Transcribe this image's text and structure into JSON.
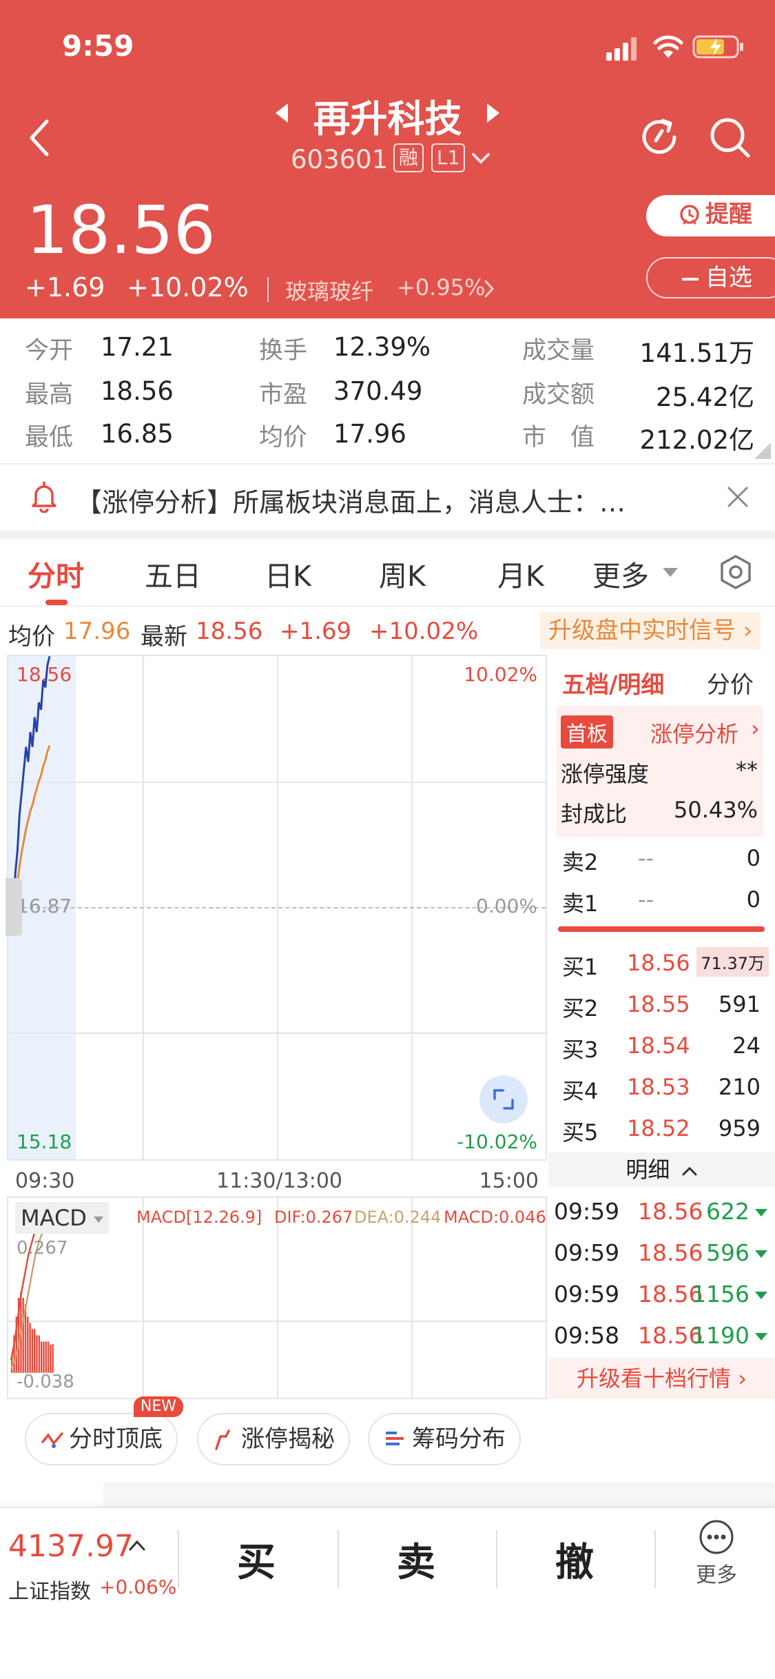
{
  "status": {
    "time": "9:59"
  },
  "header": {
    "title": "再升科技",
    "code": "603601",
    "tag_margin": "融",
    "tag_level": "L1",
    "price": "18.56",
    "change": "+1.69",
    "change_pct": "+10.02%",
    "sector_name": "玻璃玻纤",
    "sector_change": "+0.95%",
    "remind_label": "提醒",
    "watchlist_label": "自选",
    "colors": {
      "header_bg": "#e0524b",
      "up": "#e84a3d",
      "down": "#1f9e4a"
    }
  },
  "stats": [
    {
      "label": "今开",
      "value": "17.21",
      "color": "red"
    },
    {
      "label": "换手",
      "value": "12.39%",
      "color": "normal"
    },
    {
      "label": "成交量",
      "value": "141.51万",
      "color": "normal"
    },
    {
      "label": "最高",
      "value": "18.56",
      "color": "red"
    },
    {
      "label": "市盈",
      "value": "370.49",
      "color": "normal"
    },
    {
      "label": "成交额",
      "value": "25.42亿",
      "color": "normal"
    },
    {
      "label": "最低",
      "value": "16.85",
      "color": "green"
    },
    {
      "label": "均价",
      "value": "17.96",
      "color": "red"
    },
    {
      "label": "市　值",
      "value": "212.02亿",
      "color": "normal"
    }
  ],
  "notice": {
    "text": "【涨停分析】所属板块消息面上，消息人士：…"
  },
  "tabs": [
    "分时",
    "五日",
    "日K",
    "周K",
    "月K",
    "更多"
  ],
  "chart_header": {
    "avg_label": "均价",
    "avg_value": "17.96",
    "latest_label": "最新",
    "latest_value": "18.56",
    "change": "+1.69",
    "change_pct": "+10.02%",
    "upgrade_signal": "升级盘中实时信号"
  },
  "chart_data": {
    "type": "line",
    "y_labels": {
      "top": "18.56",
      "mid": "16.87",
      "bottom": "15.18",
      "top_pct": "10.02%",
      "mid_pct": "0.00%",
      "bottom_pct": "-10.02%"
    },
    "ylim": [
      15.18,
      18.56
    ],
    "x_labels": [
      "09:30",
      "11:30/13:00",
      "15:00"
    ],
    "series": [
      {
        "values": [
          16.95,
          16.8,
          17.1,
          17.25,
          17.5,
          17.65,
          17.8,
          17.95,
          17.85,
          18.05,
          17.95,
          18.15,
          18.05,
          18.25,
          18.2,
          18.4,
          18.35,
          18.5,
          18.56
        ]
      },
      {
        "values": [
          16.88,
          16.82,
          16.95,
          17.05,
          17.15,
          17.25,
          17.32,
          17.4,
          17.46,
          17.52,
          17.56,
          17.62,
          17.67,
          17.72,
          17.76,
          17.82,
          17.86,
          17.92,
          17.96
        ]
      }
    ]
  },
  "macd": {
    "label": "MACD",
    "params": "MACD[12.26.9]",
    "dif": "DIF:0.267",
    "dea": "DEA:0.244",
    "macd": "MACD:0.046",
    "top_label": "0.267",
    "bottom_label": "-0.038",
    "dif_values": [
      0.02,
      0.05,
      0.09,
      0.13,
      0.16,
      0.19,
      0.21,
      0.23,
      0.245,
      0.255,
      0.262,
      0.267
    ],
    "dea_values": [
      0.005,
      0.02,
      0.04,
      0.07,
      0.1,
      0.13,
      0.16,
      0.19,
      0.21,
      0.225,
      0.236,
      0.244
    ],
    "hist_values": [
      0.03,
      0.06,
      0.09,
      0.12,
      0.13,
      0.12,
      0.11,
      0.09,
      0.08,
      0.07,
      0.07,
      0.06,
      0.06,
      0.05,
      0.05,
      0.05,
      0.05,
      0.045,
      0.046
    ]
  },
  "order_book": {
    "title": "五档/明细",
    "alt_label": "分价",
    "badge": "首板",
    "limit_analysis": "涨停分析",
    "strength_label": "涨停强度",
    "strength_value": "**",
    "seal_ratio_label": "封成比",
    "seal_ratio_value": "50.43%",
    "asks": [
      {
        "label": "卖2",
        "price": "--",
        "volume": "0"
      },
      {
        "label": "卖1",
        "price": "--",
        "volume": "0"
      }
    ],
    "bids": [
      {
        "label": "买1",
        "price": "18.56",
        "volume": "71.37万"
      },
      {
        "label": "买2",
        "price": "18.55",
        "volume": "591"
      },
      {
        "label": "买3",
        "price": "18.54",
        "volume": "24"
      },
      {
        "label": "买4",
        "price": "18.53",
        "volume": "210"
      },
      {
        "label": "买5",
        "price": "18.52",
        "volume": "959"
      }
    ],
    "detail_label": "明细",
    "details": [
      {
        "time": "09:59",
        "price": "18.56",
        "volume": "622"
      },
      {
        "time": "09:59",
        "price": "18.56",
        "volume": "596"
      },
      {
        "time": "09:59",
        "price": "18.56",
        "volume": "1156"
      },
      {
        "time": "09:58",
        "price": "18.56",
        "volume": "1190"
      }
    ],
    "upgrade_ten": "升级看十档行情"
  },
  "chips": {
    "new_badge": "NEW",
    "top_bottom": "分时顶底",
    "limit_secret": "涨停揭秘",
    "chip_dist": "筹码分布"
  },
  "bottom_bar": {
    "index_value": "4137.97",
    "index_name": "上证指数",
    "index_change": "+0.06%",
    "buy": "买",
    "sell": "卖",
    "cancel": "撤",
    "more": "更多"
  }
}
